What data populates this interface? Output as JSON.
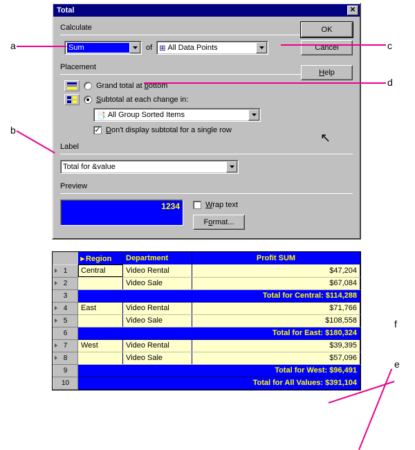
{
  "annotations": {
    "a": "a",
    "b": "b",
    "c": "c",
    "d": "d",
    "e": "e",
    "f": "f"
  },
  "dialog": {
    "title": "Total",
    "calculate_label": "Calculate",
    "function_value": "Sum",
    "of_label": "of",
    "data_points_value": "All Data Points",
    "placement_label": "Placement",
    "grand_total_label": "Grand total at bottom",
    "subtotal_label": "Subtotal at each change in:",
    "group_value": "All Group Sorted Items",
    "dont_display_label": "Don't display subtotal for a single row",
    "label_label": "Label",
    "label_value": "Total for &value",
    "preview_label": "Preview",
    "preview_value": "1234",
    "wrap_text_label": "Wrap text",
    "format_label": "Format...",
    "buttons": {
      "ok": "OK",
      "cancel": "Cancel",
      "help": "Help"
    }
  },
  "grid": {
    "headers": {
      "region": "Region",
      "department": "Department",
      "profit": "Profit SUM"
    },
    "rows": [
      {
        "n": "1",
        "tri": true,
        "region": "Central",
        "dept": "Video Rental",
        "profit": "$47,204",
        "total": false
      },
      {
        "n": "2",
        "tri": true,
        "region": "",
        "dept": "Video Sale",
        "profit": "$67,084",
        "total": false
      },
      {
        "n": "3",
        "tri": false,
        "totaltext": "Total for Central: $114,288",
        "total": true
      },
      {
        "n": "4",
        "tri": true,
        "region": "East",
        "dept": "Video Rental",
        "profit": "$71,766",
        "total": false
      },
      {
        "n": "5",
        "tri": true,
        "region": "",
        "dept": "Video Sale",
        "profit": "$108,558",
        "total": false
      },
      {
        "n": "6",
        "tri": false,
        "totaltext": "Total for East: $180,324",
        "total": true
      },
      {
        "n": "7",
        "tri": true,
        "region": "West",
        "dept": "Video Rental",
        "profit": "$39,395",
        "total": false
      },
      {
        "n": "8",
        "tri": true,
        "region": "",
        "dept": "Video Sale",
        "profit": "$57,096",
        "total": false
      },
      {
        "n": "9",
        "tri": false,
        "totaltext": "Total for West: $96,491",
        "total": true
      },
      {
        "n": "10",
        "tri": false,
        "totaltext": "Total for All Values: $391,104",
        "total": true
      }
    ]
  }
}
